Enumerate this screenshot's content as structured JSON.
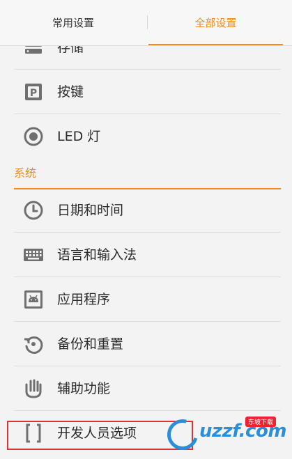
{
  "tabs": {
    "common_label": "常用设置",
    "all_label": "全部设置"
  },
  "rows": {
    "storage": "存储",
    "buttons": "按键",
    "led": "LED 灯",
    "datetime": "日期和时间",
    "language": "语言和输入法",
    "apps": "应用程序",
    "backup": "备份和重置",
    "accessibility": "辅助功能",
    "developer": "开发人员选项"
  },
  "sections": {
    "system": "系统"
  },
  "watermark": {
    "text": "uzzf.com",
    "badge": "东坡下载"
  },
  "colors": {
    "accent": "#f28a1c",
    "icon": "#6f6f6f",
    "highlight": "#dd3333"
  }
}
